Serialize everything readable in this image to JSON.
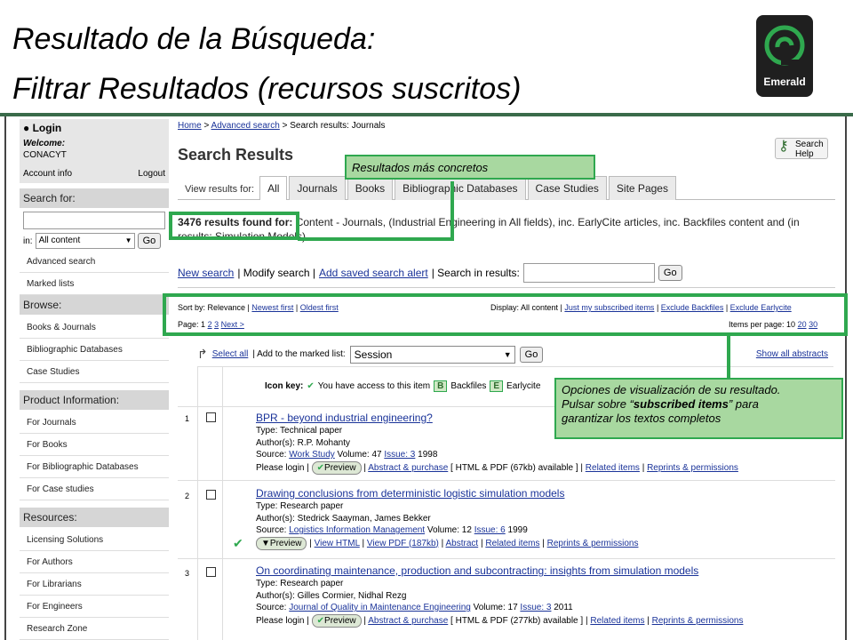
{
  "slide": {
    "title_line1": "Resultado de la Búsqueda:",
    "title_line2": "Filtrar Resultados (recursos suscritos)",
    "logo_text": "Emerald"
  },
  "sidebar": {
    "login": "Login",
    "welcome": "Welcome:",
    "user": "CONACYT",
    "account": "Account info",
    "logout": "Logout",
    "search_for": "Search for:",
    "in_label": "in:",
    "in_value": "All content",
    "go": "Go",
    "links1": [
      "Advanced search",
      "Marked lists"
    ],
    "browse_head": "Browse:",
    "browse": [
      "Books & Journals",
      "Bibliographic Databases",
      "Case Studies"
    ],
    "product_head": "Product Information:",
    "product": [
      "For Journals",
      "For Books",
      "For Bibliographic Databases",
      "For Case studies"
    ],
    "resources_head": "Resources:",
    "resources": [
      "Licensing Solutions",
      "For Authors",
      "For Librarians",
      "For Engineers",
      "Research Zone"
    ]
  },
  "main": {
    "breadcrumb_home": "Home",
    "breadcrumb_sep": " > ",
    "breadcrumb_adv": "Advanced search",
    "breadcrumb_cur": " > Search results: Journals",
    "heading": "Search Results",
    "help": "Search Help",
    "tabs_label": "View results for:",
    "tabs": [
      "All",
      "Journals",
      "Books",
      "Bibliographic Databases",
      "Case Studies",
      "Site Pages"
    ],
    "count": "3476 results found for:",
    "query": "Content - Journals, (Industrial Engineering in All fields), inc. EarlyCite articles, inc. Backfiles content and (in results: Simulation Models)",
    "new_search": "New search",
    "modify": "| Modify search |",
    "save_alert": "Add saved search alert",
    "search_in": "| Search in results:",
    "go": "Go",
    "sort_label": "Sort by: Relevance |",
    "sort_newest": "Newest first",
    "sort_oldest": "Oldest first",
    "display_label": "Display: All content |",
    "display_sub": "Just my subscribed items",
    "excl_back": "Exclude Backfiles",
    "excl_early": "Exclude Earlycite",
    "page_label": "Page:",
    "pages": [
      "1",
      "2",
      "3"
    ],
    "next": "Next >",
    "ipp_label": "Items per page: 10",
    "ipp": [
      "20",
      "30"
    ],
    "select_all": "Select all",
    "add_marked": "| Add to the marked list:",
    "session": "Session",
    "show_abstracts": "Show all abstracts",
    "icon_key": "Icon key:",
    "key_access": "You have access to this item",
    "key_b": "B",
    "key_backfiles": "Backfiles",
    "key_e": "E",
    "key_early": "Earlycite"
  },
  "results": [
    {
      "num": "1",
      "title": "BPR - beyond industrial engineering?",
      "type": "Type: Technical paper",
      "authors": "Author(s): R.P. Mohanty",
      "source_pre": "Source:",
      "source": "Work Study",
      "vol": " Volume: 47 ",
      "issue": "Issue: 3",
      "year": " 1998",
      "action_pre": "Please login |",
      "preview": "Preview",
      "l1": "Abstract & purchase",
      "mid": "[ HTML & PDF (67kb) available ] |",
      "l2": "Related items",
      "l3": "Reprints & permissions"
    },
    {
      "num": "2",
      "title": "Drawing conclusions from deterministic logistic simulation models",
      "type": "Type: Research paper",
      "authors": "Author(s): Stedrick Saayman, James Bekker",
      "source_pre": "Source:",
      "source": "Logistics Information Management",
      "vol": " Volume: 12 ",
      "issue": "Issue: 6",
      "year": " 1999",
      "preview": "Preview",
      "l1": "View HTML",
      "l2": "View PDF (187kb)",
      "l3": "Abstract",
      "l4": "Related items",
      "l5": "Reprints & permissions"
    },
    {
      "num": "3",
      "title": "On coordinating maintenance, production and subcontracting: insights from simulation models",
      "type": "Type: Research paper",
      "authors": "Author(s): Gilles Cormier, Nidhal Rezg",
      "source_pre": "Source:",
      "source": "Journal of Quality in Maintenance Engineering",
      "vol": " Volume: 17 ",
      "issue": "Issue: 3",
      "year": " 2011",
      "action_pre": "Please login |",
      "preview": "Preview",
      "l1": "Abstract & purchase",
      "mid": "[ HTML & PDF (277kb) available ] |",
      "l2": "Related items",
      "l3": "Reprints & permissions"
    }
  ],
  "annotations": {
    "a1": "Resultados más concretos",
    "a2_l1": "Opciones de visualización de su resultado.",
    "a2_l2a": "Pulsar sobre “",
    "a2_l2b": "subscribed items",
    "a2_l2c": "” para",
    "a2_l3": "garantizar los textos completos"
  },
  "colors": {
    "accent": "#2fa84f",
    "link": "#1a3399",
    "rule": "#3a6b4a"
  }
}
